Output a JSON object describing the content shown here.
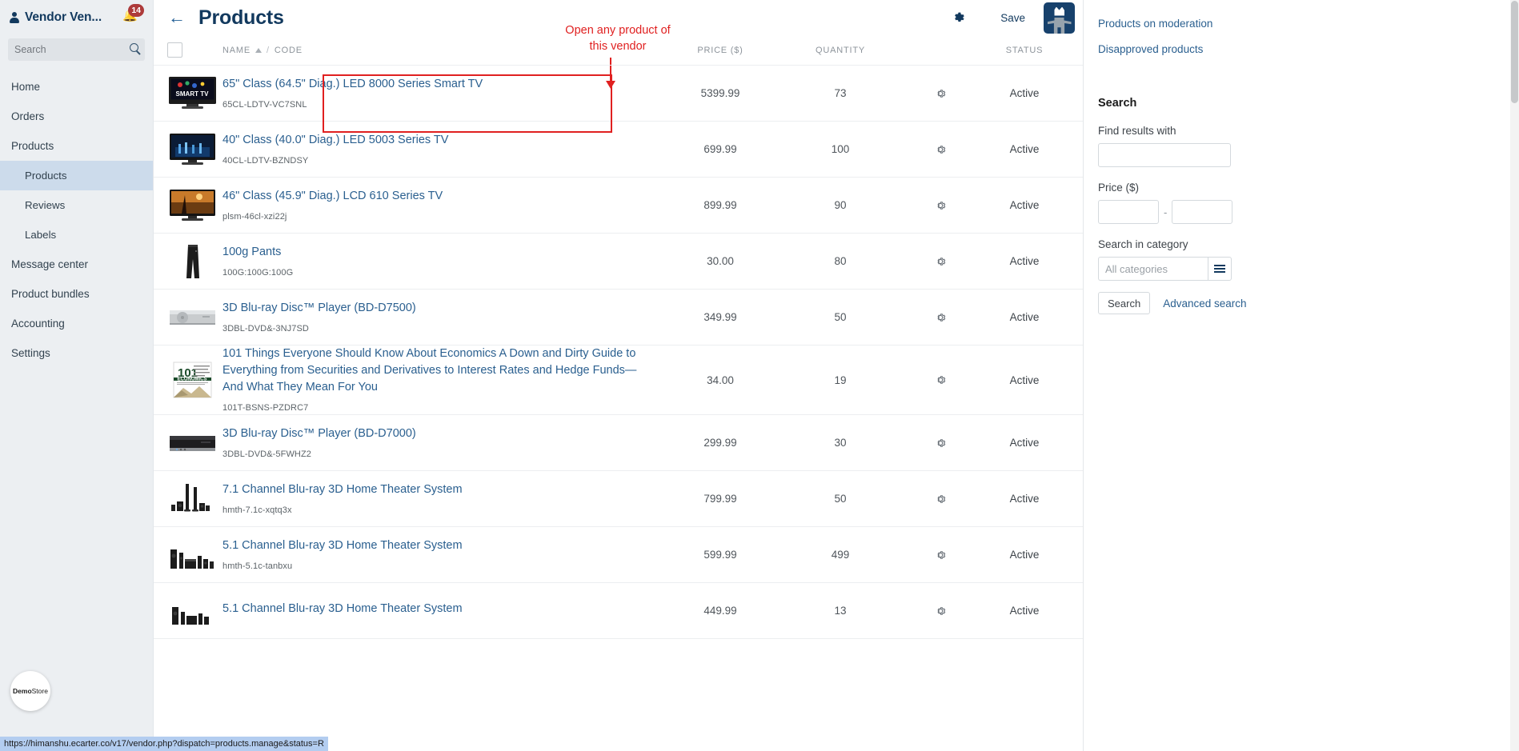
{
  "sidebar": {
    "brand": "Vendor Ven...",
    "notification_count": "14",
    "search_placeholder": "Search",
    "search_value": "",
    "items": [
      {
        "label": "Home",
        "sub": false,
        "active": false
      },
      {
        "label": "Orders",
        "sub": false,
        "active": false
      },
      {
        "label": "Products",
        "sub": false,
        "active": false
      },
      {
        "label": "Products",
        "sub": true,
        "active": true
      },
      {
        "label": "Reviews",
        "sub": true,
        "active": false
      },
      {
        "label": "Labels",
        "sub": true,
        "active": false
      },
      {
        "label": "Message center",
        "sub": false,
        "active": false
      },
      {
        "label": "Product bundles",
        "sub": false,
        "active": false
      },
      {
        "label": "Accounting",
        "sub": false,
        "active": false
      },
      {
        "label": "Settings",
        "sub": false,
        "active": false
      }
    ],
    "demo_badge_bold": "Demo",
    "demo_badge_rest": "Store"
  },
  "header": {
    "title": "Products",
    "back_icon": "arrow-left-icon",
    "gear_icon": "gear-icon",
    "save_label": "Save",
    "avatar_icon": "user-avatar"
  },
  "annotation": {
    "text_line1": "Open any product of",
    "text_line2": "this vendor",
    "color": "#e02020"
  },
  "table": {
    "columns": {
      "name": "NAME",
      "separator": "/",
      "code": "CODE",
      "price": "PRICE ($)",
      "quantity": "QUANTITY",
      "status": "STATUS"
    },
    "rows": [
      {
        "name": "65\" Class (64.5\" Diag.) LED 8000 Series Smart TV",
        "code": "65CL-LDTV-VC7SNL",
        "price": "5399.99",
        "quantity": "73",
        "status": "Active",
        "thumb": "smart-tv"
      },
      {
        "name": "40\" Class (40.0\" Diag.) LED 5003 Series TV",
        "code": "40CL-LDTV-BZNDSY",
        "price": "699.99",
        "quantity": "100",
        "status": "Active",
        "thumb": "led-tv"
      },
      {
        "name": "46\" Class (45.9\" Diag.) LCD 610 Series TV",
        "code": "plsm-46cl-xzi22j",
        "price": "899.99",
        "quantity": "90",
        "status": "Active",
        "thumb": "lcd-tv"
      },
      {
        "name": "100g Pants",
        "code": "100G:100G:100G",
        "price": "30.00",
        "quantity": "80",
        "status": "Active",
        "thumb": "pants"
      },
      {
        "name": "3D Blu-ray Disc™ Player (BD-D7500)",
        "code": "3DBL-DVD&-3NJ7SD",
        "price": "349.99",
        "quantity": "50",
        "status": "Active",
        "thumb": "bluray-silver"
      },
      {
        "name": "101 Things Everyone Should Know About Economics A Down and Dirty Guide to Everything from Securities and Derivatives to Interest Rates and Hedge Funds—And What They Mean For You",
        "code": "101T-BSNS-PZDRC7",
        "price": "34.00",
        "quantity": "19",
        "status": "Active",
        "thumb": "book"
      },
      {
        "name": "3D Blu-ray Disc™ Player (BD-D7000)",
        "code": "3DBL-DVD&-5FWHZ2",
        "price": "299.99",
        "quantity": "30",
        "status": "Active",
        "thumb": "bluray-black"
      },
      {
        "name": "7.1 Channel Blu-ray 3D Home Theater System",
        "code": "hmth-7.1c-xqtq3x",
        "price": "799.99",
        "quantity": "50",
        "status": "Active",
        "thumb": "theater71"
      },
      {
        "name": "5.1 Channel Blu-ray 3D Home Theater System",
        "code": "hmth-5.1c-tanbxu",
        "price": "599.99",
        "quantity": "499",
        "status": "Active",
        "thumb": "theater51"
      },
      {
        "name": "5.1 Channel Blu-ray 3D Home Theater System",
        "code": "",
        "price": "449.99",
        "quantity": "13",
        "status": "Active",
        "thumb": "theater51b"
      }
    ]
  },
  "right_panel": {
    "links": [
      "Products on moderation",
      "Disapproved products"
    ],
    "search_heading": "Search",
    "find_label": "Find results with",
    "find_value": "",
    "price_label": "Price ($)",
    "price_from": "",
    "price_to": "",
    "price_dash": "-",
    "category_label": "Search in category",
    "category_placeholder": "All categories",
    "category_value": "",
    "category_button_icon": "menu-icon",
    "search_button": "Search",
    "advanced_link": "Advanced search"
  },
  "statusbar": {
    "url": "https://himanshu.ecarter.co/v17/vendor.php?dispatch=products.manage&status=R"
  }
}
